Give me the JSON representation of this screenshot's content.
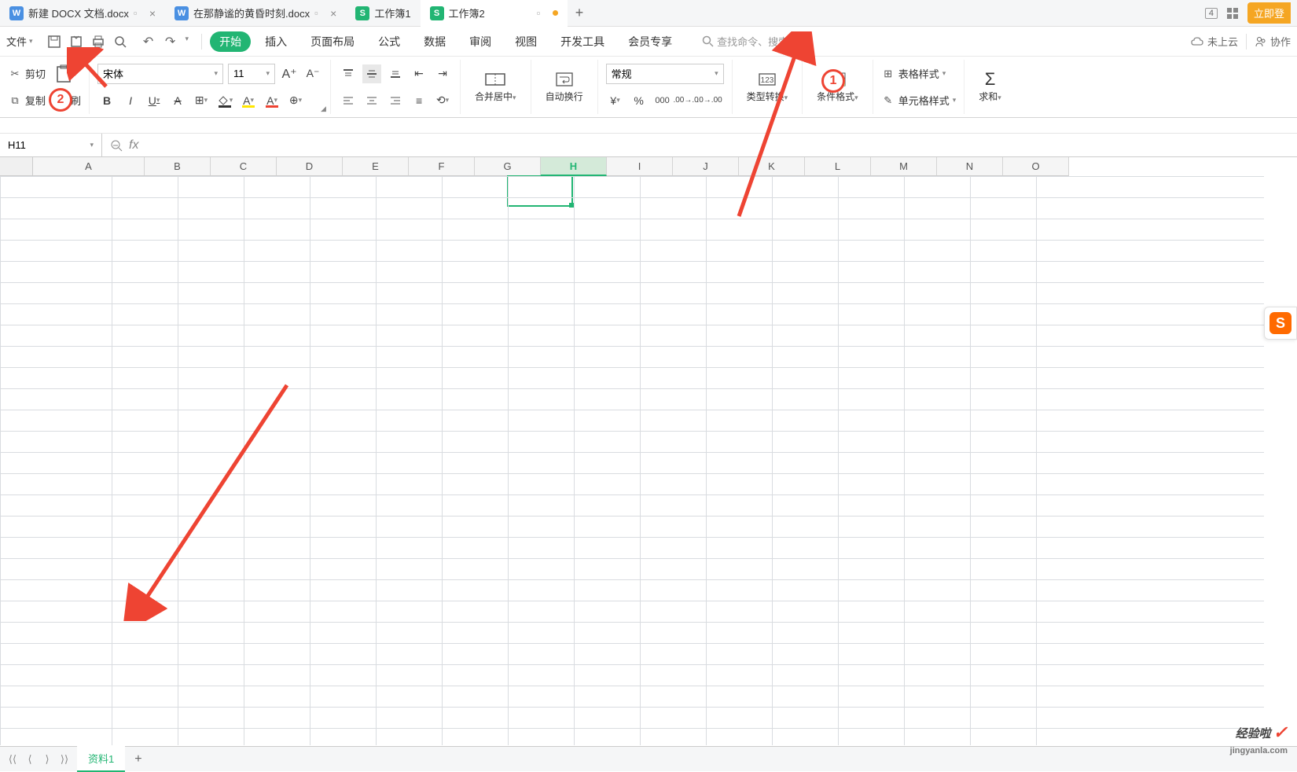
{
  "tabs": [
    {
      "icon": "W",
      "label": "新建 DOCX 文档.docx",
      "type": "word"
    },
    {
      "icon": "W",
      "label": "在那静谧的黄昏时刻.docx",
      "type": "word"
    },
    {
      "icon": "S",
      "label": "工作簿1",
      "type": "sheet"
    },
    {
      "icon": "S",
      "label": "工作簿2",
      "type": "sheet",
      "active": true
    }
  ],
  "window_count": "4",
  "login_btn": "立即登",
  "file_menu": "文件",
  "menu_tabs": [
    "开始",
    "插入",
    "页面布局",
    "公式",
    "数据",
    "审阅",
    "视图",
    "开发工具",
    "会员专享"
  ],
  "active_menu_tab": "开始",
  "search_placeholder": "查找命令、搜索模板",
  "cloud_status": "未上云",
  "collab": "协作",
  "clipboard": {
    "cut": "剪切",
    "copy": "复制",
    "painter": "格式刷"
  },
  "font": {
    "name": "宋体",
    "size": "11"
  },
  "merge": "合并居中",
  "wrap": "自动换行",
  "number_format": "常规",
  "type_convert": "类型转换",
  "cond_format": "条件格式",
  "table_style": "表格样式",
  "cell_style": "单元格样式",
  "sum": "求和",
  "name_box": "H11",
  "columns": [
    "A",
    "B",
    "C",
    "D",
    "E",
    "F",
    "G",
    "H",
    "I",
    "J",
    "K",
    "L",
    "M",
    "N",
    "O"
  ],
  "selected_col": "H",
  "sheet_name": "资料1",
  "annotations": {
    "badge1": "1",
    "badge2": "2"
  },
  "watermark": "经验啦",
  "watermark_url": "jingyanla.com"
}
